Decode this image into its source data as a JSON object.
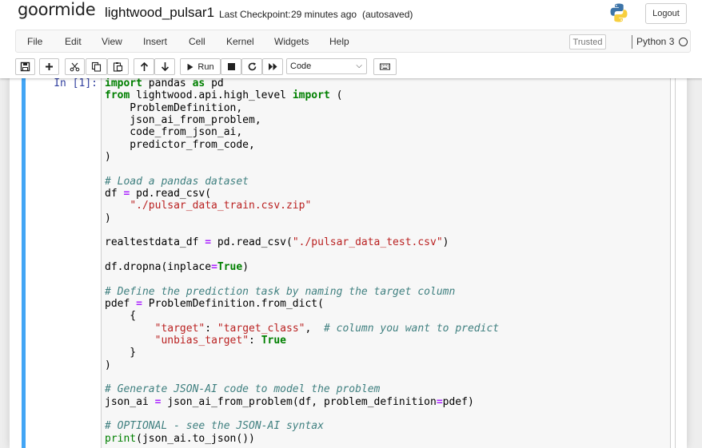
{
  "header": {
    "logo": "goormide",
    "notebook_name": "lightwood_pulsar1",
    "checkpoint_label": "Last Checkpoint:",
    "checkpoint_time": "29 minutes ago",
    "autosaved": "(autosaved)",
    "logout_label": "Logout"
  },
  "menubar": {
    "items": [
      "File",
      "Edit",
      "View",
      "Insert",
      "Cell",
      "Kernel",
      "Widgets",
      "Help"
    ],
    "trusted_label": "Trusted",
    "kernel_name": "Python 3"
  },
  "toolbar": {
    "save_icon": "save-icon",
    "add_icon": "plus-icon",
    "cut_icon": "scissors-icon",
    "copy_icon": "copy-icon",
    "paste_icon": "paste-icon",
    "up_icon": "arrow-up-icon",
    "down_icon": "arrow-down-icon",
    "run_label": "Run",
    "cell_type": "Code",
    "keyboard_icon": "keyboard-icon"
  },
  "cell": {
    "prompt": "In [1]:",
    "accent_color": "#42a5f5",
    "code_lines": [
      "import pandas as pd",
      "from lightwood.api.high_level import (",
      "    ProblemDefinition,",
      "    json_ai_from_problem,",
      "    code_from_json_ai,",
      "    predictor_from_code,",
      ")",
      "",
      "# Load a pandas dataset",
      "df = pd.read_csv(",
      "    \"./pulsar_data_train.csv.zip\"",
      ")",
      "",
      "realtestdata_df = pd.read_csv(\"./pulsar_data_test.csv\")",
      "",
      "df.dropna(inplace=True)",
      "",
      "# Define the prediction task by naming the target column",
      "pdef = ProblemDefinition.from_dict(",
      "    {",
      "        \"target\": \"target_class\",  # column you want to predict",
      "        \"unbias_target\": True",
      "    }",
      ")",
      "",
      "# Generate JSON-AI code to model the problem",
      "json_ai = json_ai_from_problem(df, problem_definition=pdef)",
      "",
      "# OPTIONAL - see the JSON-AI syntax",
      "print(json_ai.to_json())"
    ]
  }
}
